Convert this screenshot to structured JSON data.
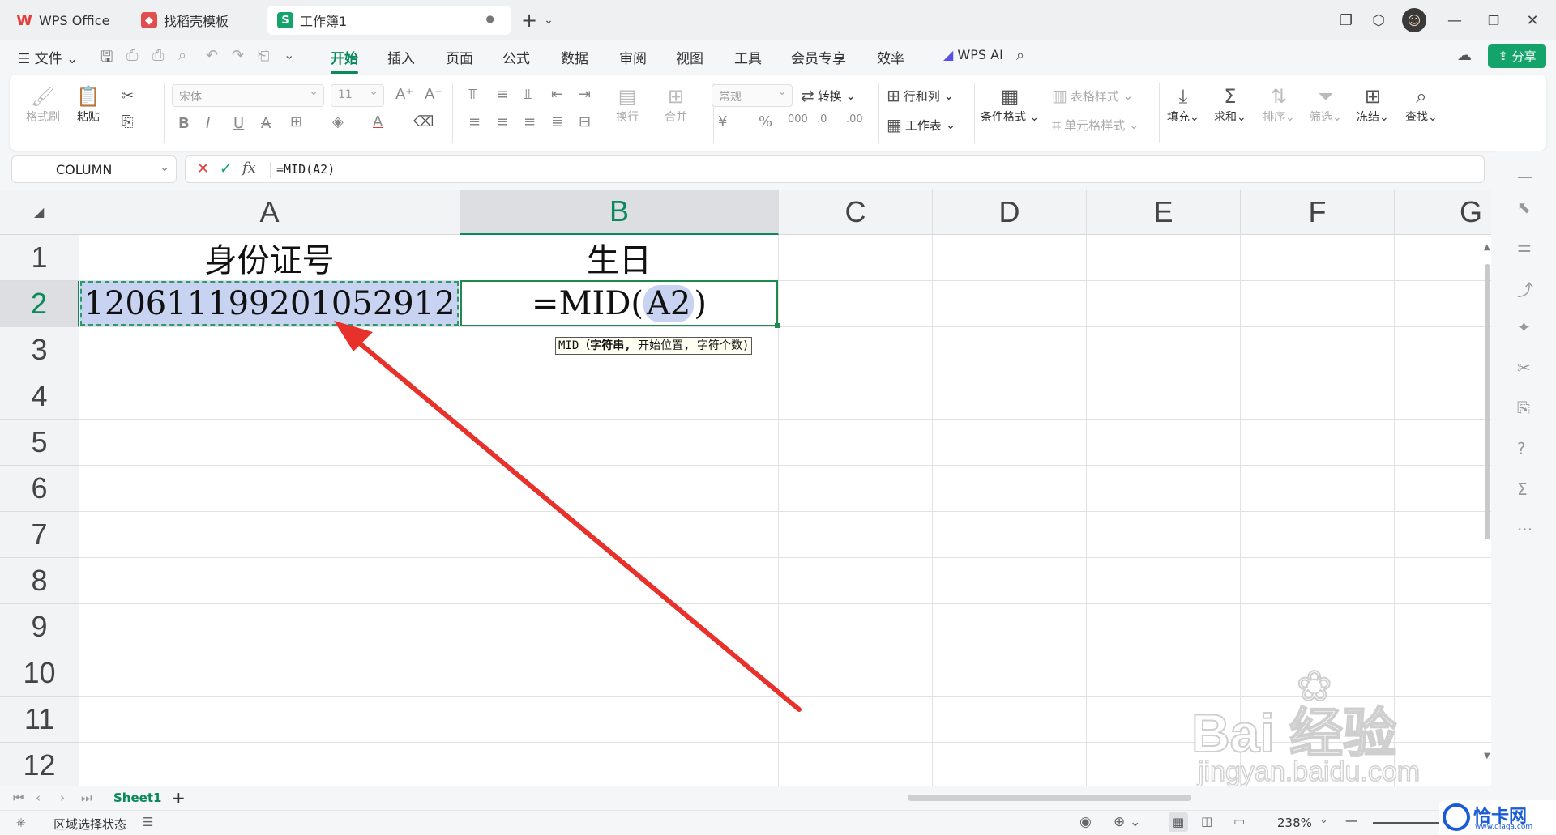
{
  "tabs": [
    {
      "label": "WPS Office",
      "icon": "wps-logo-icon"
    },
    {
      "label": "找稻壳模板",
      "icon": "docer-icon"
    },
    {
      "label": "工作簿1",
      "icon": "spreadsheet-icon",
      "active": true
    }
  ],
  "menu": {
    "file": "文件",
    "items": [
      "开始",
      "插入",
      "页面",
      "公式",
      "数据",
      "审阅",
      "视图",
      "工具",
      "会员专享",
      "效率"
    ],
    "active": "开始",
    "wps_ai": "WPS AI",
    "share": "分享"
  },
  "ribbon": {
    "format_painter": "格式刷",
    "paste": "粘贴",
    "font_name": "宋体",
    "font_size": "11",
    "wrap": "换行",
    "merge": "合并",
    "number_format": "常规",
    "convert": "转换",
    "row_col": "行和列",
    "worksheet": "工作表",
    "cond_format": "条件格式",
    "table_style": "表格样式",
    "cell_style": "单元格样式",
    "fill": "填充",
    "sum": "求和",
    "sort": "排序",
    "filter": "筛选",
    "freeze": "冻结",
    "find": "查找"
  },
  "formula_bar": {
    "name_box": "COLUMN",
    "formula": "=MID(A2)"
  },
  "columns": [
    "A",
    "B",
    "C",
    "D",
    "E",
    "F",
    "G"
  ],
  "rows": [
    "1",
    "2",
    "3",
    "4",
    "5",
    "6",
    "7",
    "8",
    "9",
    "10",
    "11",
    "12"
  ],
  "cells": {
    "A1": "身份证号",
    "B1": "生日",
    "A2": "120611199201052912",
    "B2_prefix": "=MID(",
    "B2_ref": "A2",
    "B2_suffix": ")"
  },
  "tooltip": {
    "fn": "MID",
    "arg1": "字符串,",
    "rest": "开始位置, 字符个数)"
  },
  "sheets": [
    "Sheet1"
  ],
  "status": {
    "mode": "区域选择状态",
    "zoom": "238%"
  },
  "watermark": {
    "baidu": "Bai 经验",
    "url": "jingyan.baidu.com",
    "site": "恰卡网",
    "site_url": "www.qiaqa.com"
  },
  "colors": {
    "accent": "#0a8a5a",
    "selection": "#c7d3f0",
    "arrow": "#e8312a"
  }
}
